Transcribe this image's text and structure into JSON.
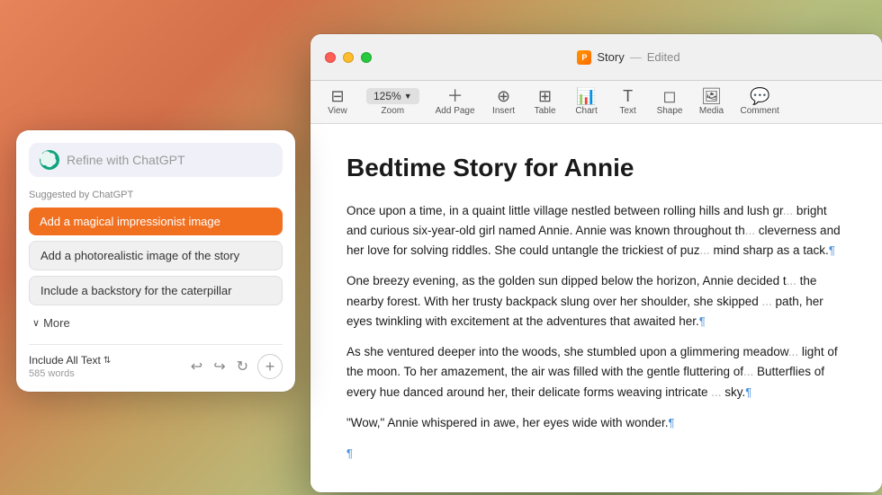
{
  "window": {
    "title": "Story",
    "title_separator": "—",
    "status": "Edited",
    "title_icon_label": "P"
  },
  "toolbar": {
    "zoom_value": "125%",
    "items": [
      {
        "id": "view",
        "icon": "⊟",
        "label": "View"
      },
      {
        "id": "zoom",
        "icon": "",
        "label": "Zoom"
      },
      {
        "id": "add-page",
        "icon": "⊞",
        "label": "Add Page"
      },
      {
        "id": "insert",
        "icon": "⊕",
        "label": "Insert"
      },
      {
        "id": "table",
        "icon": "⊞",
        "label": "Table"
      },
      {
        "id": "chart",
        "icon": "◫",
        "label": "Chart"
      },
      {
        "id": "text",
        "icon": "T",
        "label": "Text"
      },
      {
        "id": "shape",
        "icon": "◻",
        "label": "Shape"
      },
      {
        "id": "media",
        "icon": "⊡",
        "label": "Media"
      },
      {
        "id": "comment",
        "icon": "💬",
        "label": "Comment"
      }
    ]
  },
  "document": {
    "title": "Bedtime Story for Annie",
    "paragraphs": [
      {
        "id": 1,
        "text": "Once upon a time, in a quaint little village nestled between rolling hills and lush gr... bright and curious six-year-old girl named Annie. Annie was known throughout th... cleverness and her love for solving riddles. She could untangle the trickiest of puz... mind sharp as a tack.¶"
      },
      {
        "id": 2,
        "text": "One breezy evening, as the golden sun dipped below the horizon, Annie decided t... the nearby forest. With her trusty backpack slung over her shoulder, she skipped ... path, her eyes twinkling with excitement at the adventures that awaited her.¶"
      },
      {
        "id": 3,
        "text": "As she ventured deeper into the woods, she stumbled upon a glimmering meadow... light of the moon. To her amazement, the air was filled with the gentle fluttering of... Butterflies of every hue danced around her, their delicate forms weaving intricate ... sky.¶"
      },
      {
        "id": 4,
        "text": "\"Wow,\" Annie whispered in awe, her eyes wide with wonder.¶"
      }
    ]
  },
  "chatgpt_panel": {
    "search_placeholder": "Refine with ChatGPT",
    "suggested_label": "Suggested by ChatGPT",
    "suggestions": [
      {
        "id": 1,
        "text": "Add a magical impressionist image",
        "active": true
      },
      {
        "id": 2,
        "text": "Add a photorealistic image of the story",
        "active": false
      },
      {
        "id": 3,
        "text": "Include a backstory for the caterpillar",
        "active": false
      }
    ],
    "more_label": "More",
    "footer": {
      "include_label": "Include All Text",
      "word_count": "585 words"
    },
    "actions": {
      "undo_label": "↩",
      "redo_label": "↪",
      "refresh_label": "↻",
      "add_label": "+"
    }
  }
}
